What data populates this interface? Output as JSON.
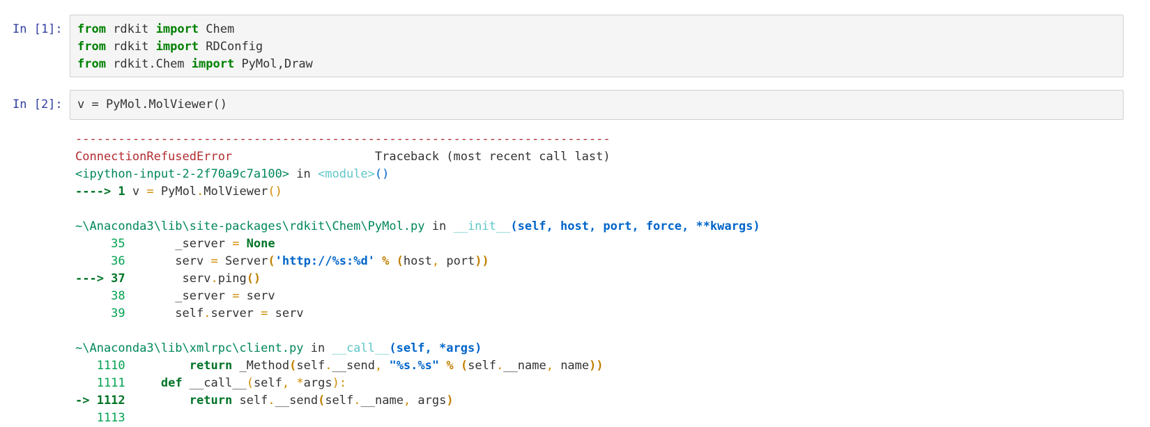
{
  "cells": [
    {
      "prompt": "In [1]:",
      "lines": [
        [
          {
            "t": "from",
            "c": "kw"
          },
          {
            "t": " rdkit ",
            "c": "txt"
          },
          {
            "t": "import",
            "c": "kw"
          },
          {
            "t": " Chem",
            "c": "txt"
          }
        ],
        [
          {
            "t": "from",
            "c": "kw"
          },
          {
            "t": " rdkit ",
            "c": "txt"
          },
          {
            "t": "import",
            "c": "kw"
          },
          {
            "t": " RDConfig",
            "c": "txt"
          }
        ],
        [
          {
            "t": "from",
            "c": "kw"
          },
          {
            "t": " rdkit.Chem ",
            "c": "txt"
          },
          {
            "t": "import",
            "c": "kw"
          },
          {
            "t": " PyMol,Draw",
            "c": "txt"
          }
        ]
      ]
    },
    {
      "prompt": "In [2]:",
      "lines": [
        [
          {
            "t": "v = PyMol.MolViewer()",
            "c": "txt"
          }
        ]
      ]
    }
  ],
  "output": {
    "lines": [
      [
        {
          "t": "---------------------------------------------------------------------------",
          "c": "dash"
        }
      ],
      [
        {
          "t": "ConnectionRefusedError",
          "c": "err-name"
        },
        {
          "t": "                    Traceback (most recent call last)",
          "c": "txt"
        }
      ],
      [
        {
          "t": "<ipython-input-2-2f70a9c7a100>",
          "c": "green"
        },
        {
          "t": " in ",
          "c": "txt"
        },
        {
          "t": "<module>",
          "c": "cyan"
        },
        {
          "t": "()",
          "c": "blue"
        }
      ],
      [
        {
          "t": "----> 1",
          "c": "green-b"
        },
        {
          "t": " v ",
          "c": "txt"
        },
        {
          "t": "=",
          "c": "orange"
        },
        {
          "t": " PyMol",
          "c": "txt"
        },
        {
          "t": ".",
          "c": "orange"
        },
        {
          "t": "MolViewer",
          "c": "txt"
        },
        {
          "t": "()",
          "c": "orange"
        }
      ],
      [],
      [
        {
          "t": "~\\Anaconda3\\lib\\site-packages\\rdkit\\Chem\\PyMol.py",
          "c": "green"
        },
        {
          "t": " in ",
          "c": "txt"
        },
        {
          "t": "__init__",
          "c": "cyan"
        },
        {
          "t": "(self, host, port, force, **kwargs)",
          "c": "blue-b"
        }
      ],
      [
        {
          "t": "     35",
          "c": "lineno"
        },
        {
          "t": "       _server ",
          "c": "txt"
        },
        {
          "t": "=",
          "c": "orange"
        },
        {
          "t": " None",
          "c": "green-b"
        }
      ],
      [
        {
          "t": "     36",
          "c": "lineno"
        },
        {
          "t": "       serv ",
          "c": "txt"
        },
        {
          "t": "=",
          "c": "orange"
        },
        {
          "t": " Server",
          "c": "txt"
        },
        {
          "t": "(",
          "c": "orange-b"
        },
        {
          "t": "'http://%s:%d'",
          "c": "blue-b"
        },
        {
          "t": " % ",
          "c": "orange-b"
        },
        {
          "t": "(",
          "c": "orange-b"
        },
        {
          "t": "host",
          "c": "txt"
        },
        {
          "t": ",",
          "c": "orange"
        },
        {
          "t": " port",
          "c": "txt"
        },
        {
          "t": "))",
          "c": "orange-b"
        }
      ],
      [
        {
          "t": "---> 37",
          "c": "green-b"
        },
        {
          "t": "        serv",
          "c": "txt"
        },
        {
          "t": ".",
          "c": "orange"
        },
        {
          "t": "ping",
          "c": "txt"
        },
        {
          "t": "()",
          "c": "orange-b"
        }
      ],
      [
        {
          "t": "     38",
          "c": "lineno"
        },
        {
          "t": "       _server ",
          "c": "txt"
        },
        {
          "t": "=",
          "c": "orange"
        },
        {
          "t": " serv",
          "c": "txt"
        }
      ],
      [
        {
          "t": "     39",
          "c": "lineno"
        },
        {
          "t": "       self",
          "c": "txt"
        },
        {
          "t": ".",
          "c": "orange"
        },
        {
          "t": "server ",
          "c": "txt"
        },
        {
          "t": "=",
          "c": "orange"
        },
        {
          "t": " serv",
          "c": "txt"
        }
      ],
      [],
      [
        {
          "t": "~\\Anaconda3\\lib\\xmlrpc\\client.py",
          "c": "green"
        },
        {
          "t": " in ",
          "c": "txt"
        },
        {
          "t": "__call__",
          "c": "cyan"
        },
        {
          "t": "(self, *args)",
          "c": "blue-b"
        }
      ],
      [
        {
          "t": "   1110",
          "c": "lineno"
        },
        {
          "t": "         ",
          "c": "txt"
        },
        {
          "t": "return",
          "c": "green-b"
        },
        {
          "t": " _Method",
          "c": "txt"
        },
        {
          "t": "(",
          "c": "orange-b"
        },
        {
          "t": "self",
          "c": "txt"
        },
        {
          "t": ".",
          "c": "orange"
        },
        {
          "t": "__send",
          "c": "txt"
        },
        {
          "t": ", ",
          "c": "orange"
        },
        {
          "t": "\"%s.%s\"",
          "c": "blue-b"
        },
        {
          "t": " % ",
          "c": "orange-b"
        },
        {
          "t": "(",
          "c": "orange-b"
        },
        {
          "t": "self",
          "c": "txt"
        },
        {
          "t": ".",
          "c": "orange"
        },
        {
          "t": "__name",
          "c": "txt"
        },
        {
          "t": ",",
          "c": "orange"
        },
        {
          "t": " name",
          "c": "txt"
        },
        {
          "t": "))",
          "c": "orange-b"
        }
      ],
      [
        {
          "t": "   1111",
          "c": "lineno"
        },
        {
          "t": "     ",
          "c": "txt"
        },
        {
          "t": "def",
          "c": "green-b"
        },
        {
          "t": " __call__",
          "c": "txt"
        },
        {
          "t": "(",
          "c": "orange"
        },
        {
          "t": "self",
          "c": "txt"
        },
        {
          "t": ",",
          "c": "orange"
        },
        {
          "t": " ",
          "c": "txt"
        },
        {
          "t": "*",
          "c": "orange"
        },
        {
          "t": "args",
          "c": "txt"
        },
        {
          "t": "):",
          "c": "orange"
        }
      ],
      [
        {
          "t": "-> 1112",
          "c": "green-b"
        },
        {
          "t": "         ",
          "c": "txt"
        },
        {
          "t": "return",
          "c": "green-b"
        },
        {
          "t": " self",
          "c": "txt"
        },
        {
          "t": ".",
          "c": "orange"
        },
        {
          "t": "__send",
          "c": "txt"
        },
        {
          "t": "(",
          "c": "orange-b"
        },
        {
          "t": "self",
          "c": "txt"
        },
        {
          "t": ".",
          "c": "orange"
        },
        {
          "t": "__name",
          "c": "txt"
        },
        {
          "t": ",",
          "c": "orange"
        },
        {
          "t": " args",
          "c": "txt"
        },
        {
          "t": ")",
          "c": "orange-b"
        }
      ],
      [
        {
          "t": "   1113",
          "c": "lineno"
        }
      ]
    ]
  }
}
